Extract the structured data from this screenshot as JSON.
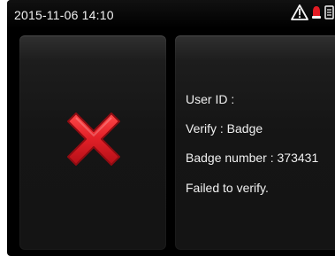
{
  "status_bar": {
    "datetime": "2015-11-06 14:10",
    "icons": [
      "warning-icon",
      "alarm-icon",
      "device-icon"
    ]
  },
  "result": {
    "icon": "error-x-icon",
    "lines": [
      "User ID :",
      "Verify : Badge",
      "Badge number : 373431",
      "Failed to verify."
    ]
  },
  "colors": {
    "background": "#000000",
    "panel": "#171717",
    "text": "#f0f0f0",
    "error_red": "#d81f26",
    "warning_red": "#e31b23"
  }
}
